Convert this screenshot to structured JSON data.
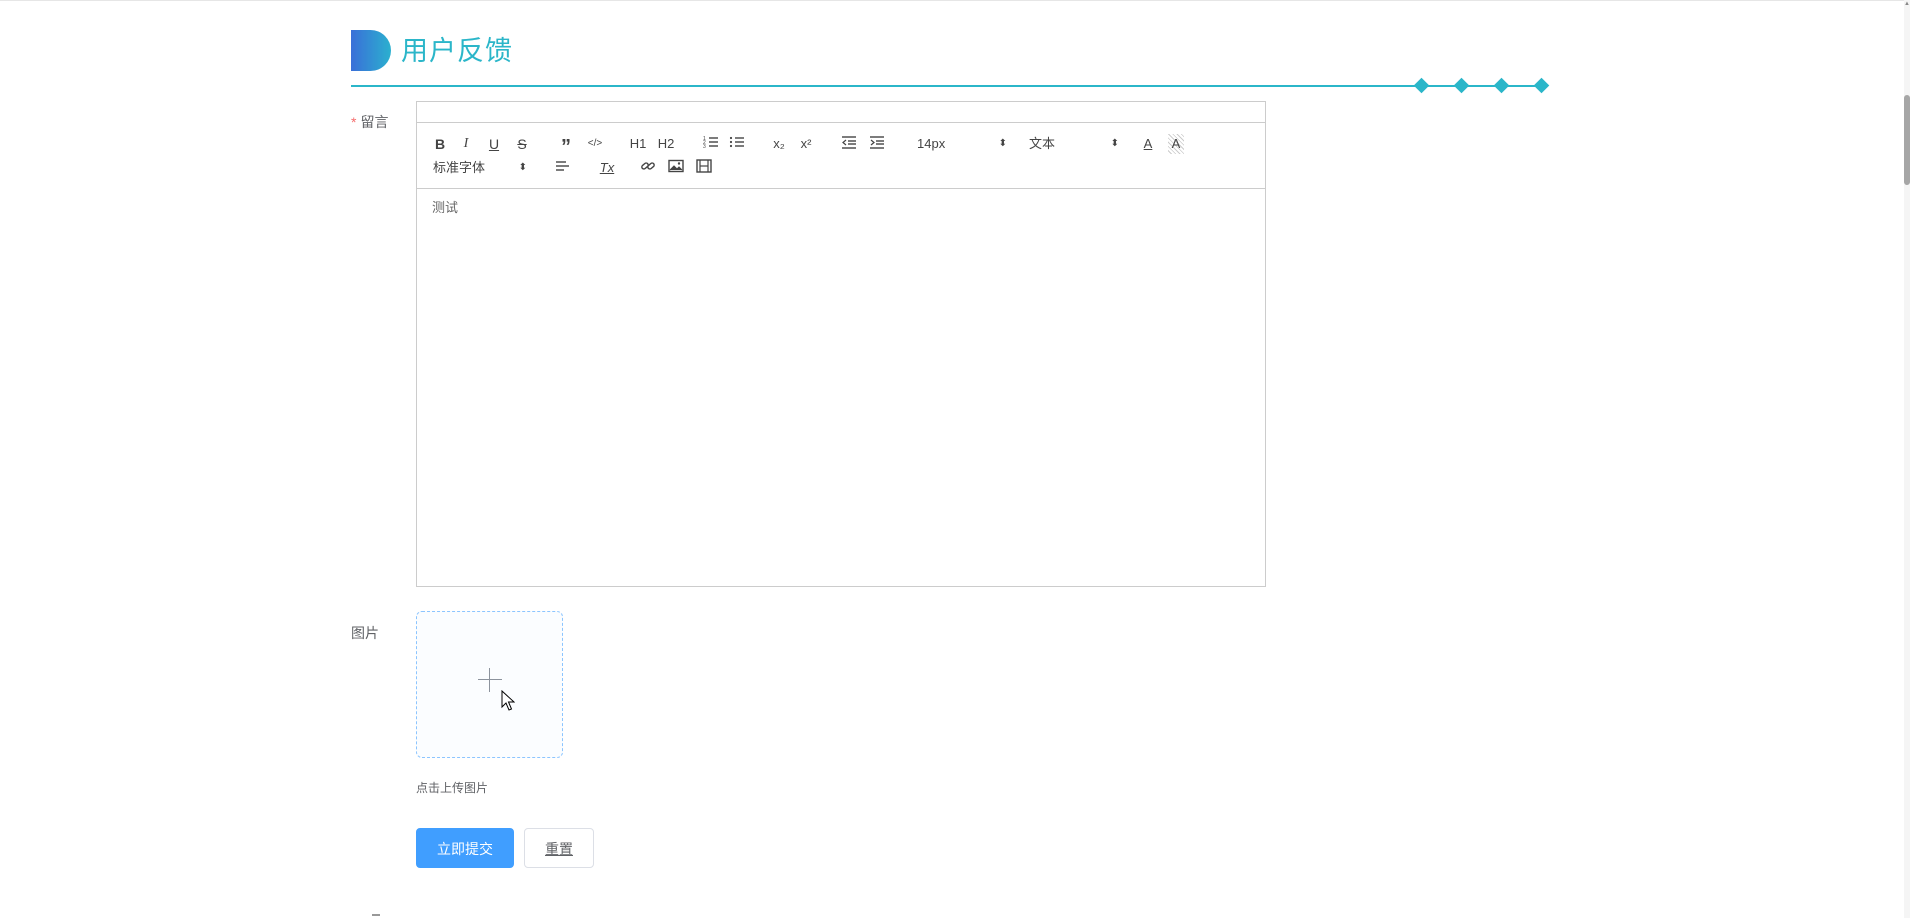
{
  "header": {
    "title": "用户反馈",
    "accent_color": "#2bb6c9"
  },
  "form": {
    "message_label": "留言",
    "required_mark": "*",
    "image_label": "图片"
  },
  "editor": {
    "toolbar": {
      "bold": "B",
      "italic": "I",
      "underline": "U",
      "strike": "S",
      "blockquote": "”",
      "code": "</>",
      "h1": "H1",
      "h2": "H2",
      "ordered_list": "list-ordered-icon",
      "bullet_list": "list-bullet-icon",
      "subscript": "x₂",
      "superscript": "x²",
      "outdent": "outdent-icon",
      "indent": "indent-icon",
      "size_value": "14px",
      "header_value": "文本",
      "font_value": "标准字体",
      "text_color": "A",
      "background_color": "A",
      "align": "align-icon",
      "clean": "Tx",
      "link": "link-icon",
      "image": "image-icon",
      "video": "video-icon"
    },
    "content": "测试"
  },
  "upload": {
    "tip": "点击上传图片"
  },
  "buttons": {
    "submit": "立即提交",
    "reset": "重置"
  }
}
